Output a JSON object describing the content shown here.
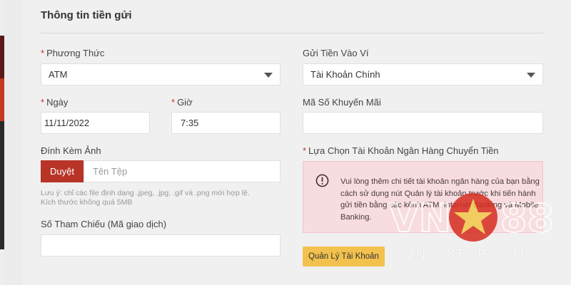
{
  "form": {
    "title": "Thông tin tiền gửi",
    "method": {
      "label": "Phương Thức",
      "required": true,
      "value": "ATM"
    },
    "wallet": {
      "label": "Gửi Tiền Vào Ví",
      "value": "Tài Khoản Chính"
    },
    "date": {
      "label": "Ngày",
      "required": true,
      "value": "11/11/2022"
    },
    "time": {
      "label": "Giờ",
      "required": true,
      "value": "7:35"
    },
    "promo": {
      "label": "Mã Số Khuyến Mãi",
      "value": ""
    },
    "attachment": {
      "label": "Đính Kèm Ảnh",
      "browse_label": "Duyệt",
      "file_placeholder": "Tên Tệp",
      "note_line1": "Lưu ý: chỉ các file định dạng .jpeg, .jpg, .gif và .png mới hợp lệ.",
      "note_line2": "Kích thước không quá 5MB"
    },
    "reference": {
      "label": "Số Tham Chiếu (Mã giao dịch)",
      "value": ""
    },
    "bank_select": {
      "label": "Lựa Chọn Tài Khoản Ngân Hàng Chuyển Tiền",
      "required": true,
      "alert_text": "Vui lòng thêm chi tiết tài khoản ngân hàng của bạn bằng cách sử dụng nút Quản lý tài khoản trước khi tiến hành gửi tiền bằng các kênh ATM, Internet Banking và Mobile Banking.",
      "manage_button": "Quản Lý Tài Khoản"
    }
  },
  "watermark": {
    "logo_text": "VN888",
    "url": "VN888TOP.COM"
  },
  "colors": {
    "browse": "#b83427",
    "manage": "#f2c14e",
    "alert_bg": "#f7dde0",
    "required": "#c0392b"
  }
}
